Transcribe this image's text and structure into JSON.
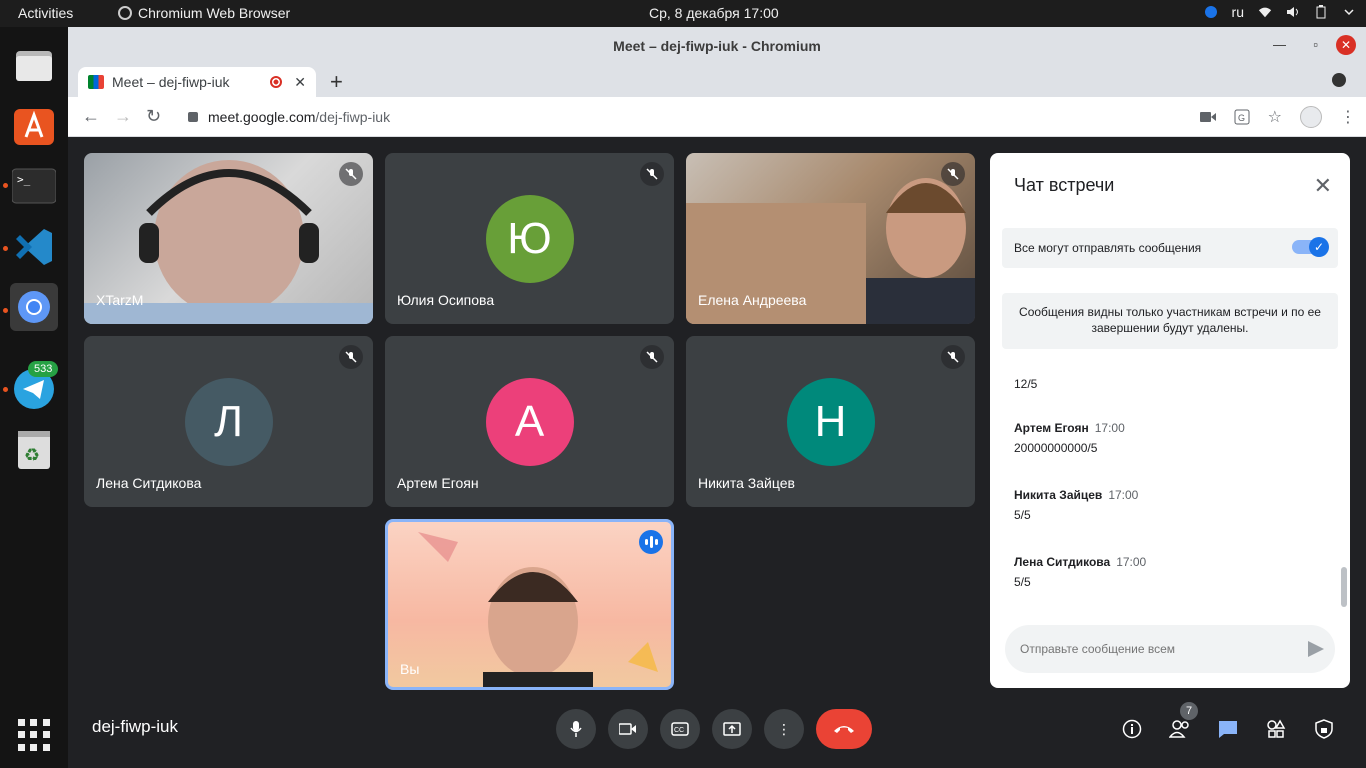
{
  "os": {
    "activities": "Activities",
    "app_name": "Chromium Web Browser",
    "clock": "Ср, 8 декабря  17:00",
    "lang": "ru",
    "telegram_badge": "533"
  },
  "browser": {
    "window_title": "Meet – dej-fiwp-iuk - Chromium",
    "tab_title": "Meet – dej-fiwp-iuk",
    "url_host": "meet.google.com",
    "url_path": "/dej-fiwp-iuk"
  },
  "tiles": [
    {
      "name": "XTarzM"
    },
    {
      "name": "Юлия Осипова",
      "initial": "Ю"
    },
    {
      "name": "Елена Андреева"
    },
    {
      "name": "Лена Ситдикова",
      "initial": "Л"
    },
    {
      "name": "Артем Егоян",
      "initial": "А"
    },
    {
      "name": "Никита Зайцев",
      "initial": "Н"
    },
    {
      "name": "Вы"
    }
  ],
  "chat": {
    "title": "Чат встречи",
    "toggle_label": "Все могут отправлять сообщения",
    "notice": "Сообщения видны только участникам встречи и по ее завершении будут удалены.",
    "messages": [
      {
        "text": "12/5"
      },
      {
        "author": "Артем Егоян",
        "time": "17:00",
        "text": "20000000000/5"
      },
      {
        "author": "Никита Зайцев",
        "time": "17:00",
        "text": "5/5"
      },
      {
        "author": "Лена Ситдикова",
        "time": "17:00",
        "text": "5/5"
      }
    ],
    "input_placeholder": "Отправьте сообщение всем"
  },
  "meeting": {
    "code": "dej-fiwp-iuk",
    "participants_count": "7"
  },
  "colors": {
    "accent": "#1a73e8",
    "hangup": "#ea4335",
    "tile_bg": "#3c4043",
    "avatar_yu": "#689f38",
    "avatar_l": "#455a64",
    "avatar_a": "#ec407a",
    "avatar_n": "#00897b"
  }
}
